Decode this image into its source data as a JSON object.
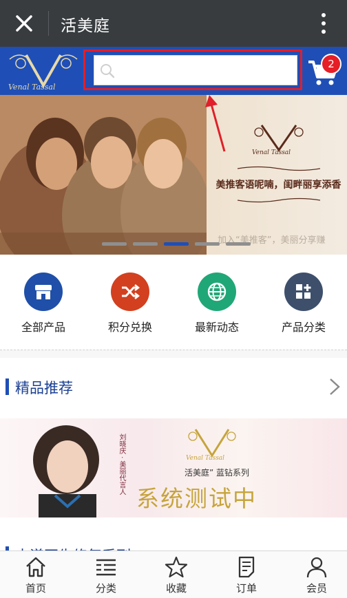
{
  "titlebar": {
    "title": "活美庭"
  },
  "header": {
    "brand_script": "Venal Tassal",
    "search": {
      "placeholder": "",
      "value": ""
    },
    "cart_count": "2"
  },
  "banner": {
    "slogan": "美推客语呢喃，闺畔丽享添香",
    "caption": "加入“美推客”，美丽分享赚",
    "brand_script": "Venal Tassal",
    "slides": 5,
    "active_slide": 3
  },
  "quicknav": [
    {
      "label": "全部产品",
      "icon": "store-icon",
      "color": "#1f4fa8"
    },
    {
      "label": "积分兑换",
      "icon": "shuffle-icon",
      "color": "#d2401f"
    },
    {
      "label": "最新动态",
      "icon": "globe-icon",
      "color": "#20a777"
    },
    {
      "label": "产品分类",
      "icon": "grid-plus-icon",
      "color": "#3d4f6b"
    }
  ],
  "section1": {
    "title": "精品推荐"
  },
  "promo": {
    "brand_script": "Venal Tassal",
    "sub": "活美庭” 蓝钻系列",
    "test": "系统测试中",
    "vert": "刘晓庆 · 美丽代言人"
  },
  "section2": {
    "title": "水漾再生修复系列"
  },
  "tabbar": [
    {
      "label": "首页",
      "icon": "home-icon"
    },
    {
      "label": "分类",
      "icon": "list-icon"
    },
    {
      "label": "收藏",
      "icon": "star-icon"
    },
    {
      "label": "订单",
      "icon": "order-icon"
    },
    {
      "label": "会员",
      "icon": "user-icon"
    }
  ],
  "colors": {
    "brand_blue": "#1f4fb6",
    "titlebar": "#383c3f",
    "accent_red": "#e01f2a"
  }
}
